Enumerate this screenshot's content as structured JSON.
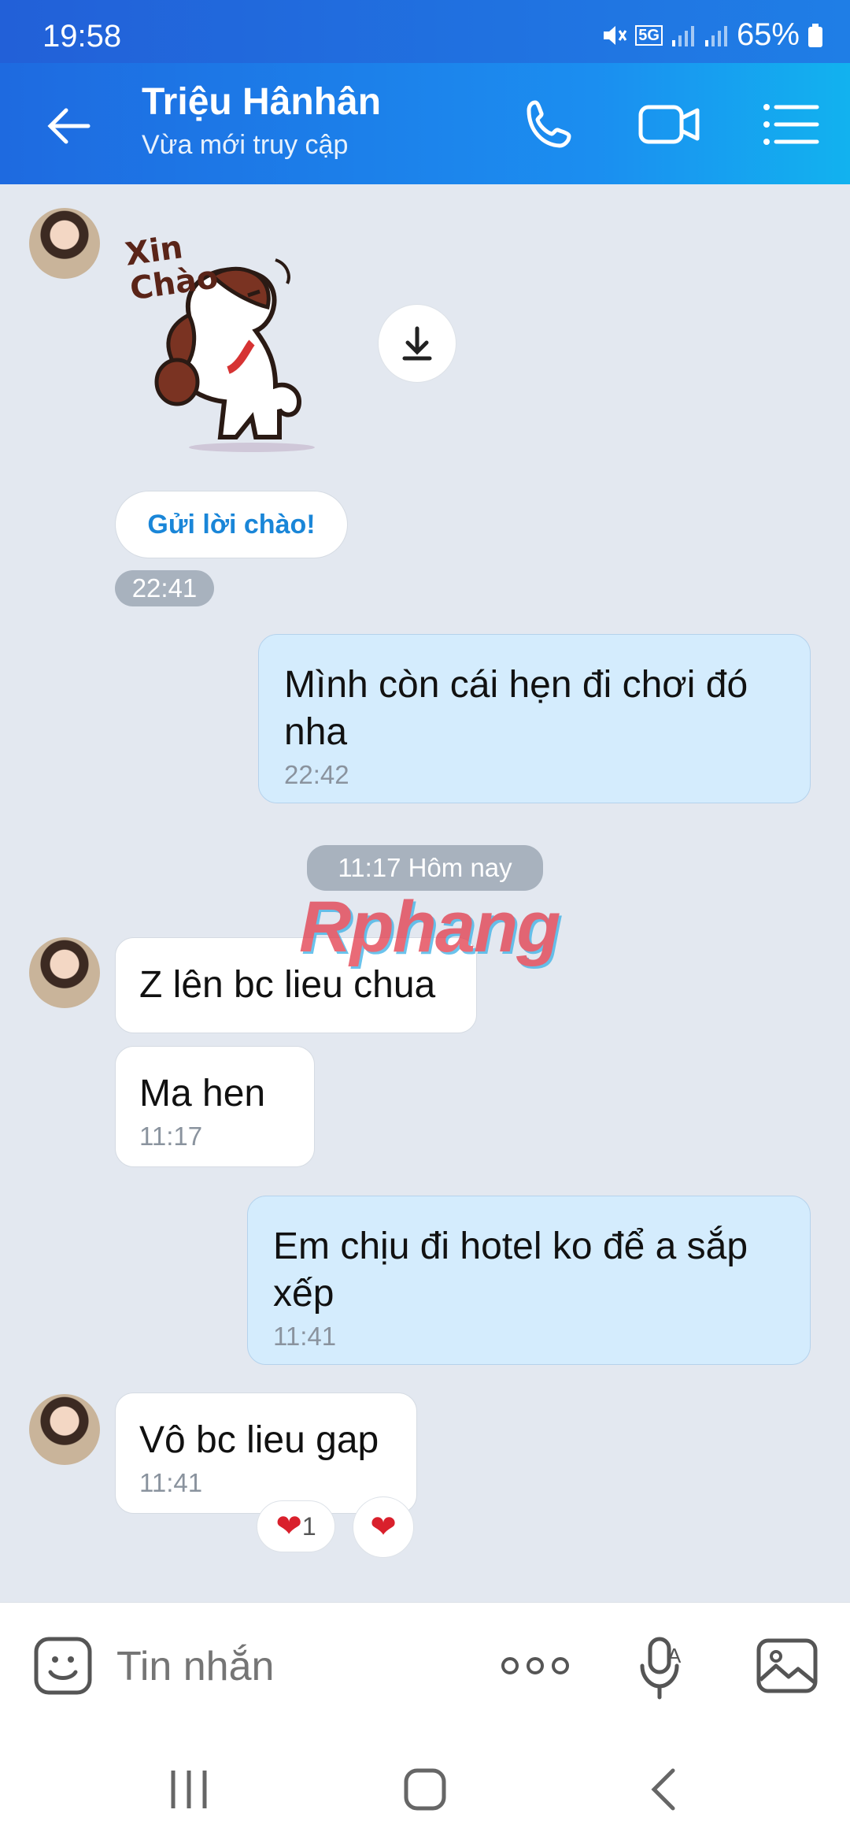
{
  "status": {
    "time": "19:58",
    "battery": "65%",
    "network": "5G"
  },
  "header": {
    "name": "Triệu Hânhân",
    "subtitle": "Vừa mới truy cập"
  },
  "greeting_button": "Gửi lời chào!",
  "sticker_text": [
    "Xin",
    "Chào"
  ],
  "messages": [
    {
      "time": "22:41"
    },
    {
      "text": "Mình còn cái hẹn đi chơi đó nha",
      "time": "22:42"
    },
    {
      "divider": "11:17 Hôm nay"
    },
    {
      "text": "Z lên bc lieu chua"
    },
    {
      "text": "Ma hen",
      "time": "11:17"
    },
    {
      "text": "Em chịu đi hotel ko để a sắp xếp",
      "time": "11:41"
    },
    {
      "text": "Vô bc lieu gap",
      "time": "11:41",
      "reaction_count": "1"
    }
  ],
  "watermark": "Rphang",
  "input": {
    "placeholder": "Tin nhắn"
  },
  "icons": {
    "back": "arrow-left-icon",
    "call": "phone-icon",
    "video": "video-camera-icon",
    "menu": "list-menu-icon",
    "download": "download-icon",
    "emoji": "emoji-icon",
    "more": "more-dots-icon",
    "voice": "voice-text-icon",
    "gallery": "image-icon",
    "heart": "heart-icon"
  },
  "colors": {
    "header": "#1b8ef0",
    "outgoing": "#d4ecfd",
    "incoming": "#ffffff",
    "background": "#e3e8f0",
    "accent": "#1a86d8"
  }
}
